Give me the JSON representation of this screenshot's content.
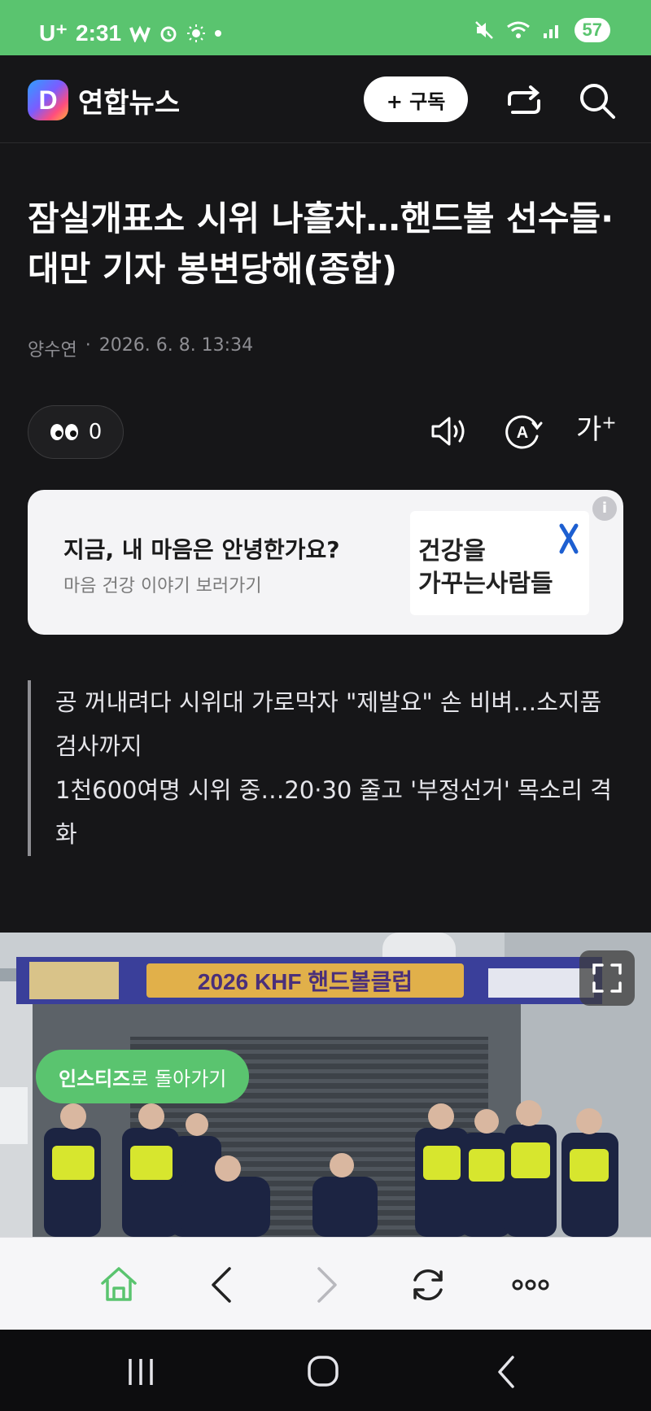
{
  "status": {
    "carrier": "U⁺",
    "time": "2:31",
    "battery": "57"
  },
  "header": {
    "logo_letter": "D",
    "brand": "연합뉴스",
    "subscribe_label": "+ 구독"
  },
  "article": {
    "title": "잠실개표소 시위 나흘차…핸드볼 선수들·대만 기자 봉변당해(종합)",
    "author": "양수연",
    "separator": "·",
    "datetime": "2026. 6. 8. 13:34",
    "reaction_count": "0",
    "font_control": "가",
    "summary": [
      "공 꺼내려다 시위대 가로막자 \"제발요\" 손 비벼…소지품 검사까지",
      "1천600여명 시위 중…20·30 줄고 '부정선거' 목소리 격화"
    ]
  },
  "ad": {
    "headline": "지금, 내 마음은 안녕한가요?",
    "subline": "마음 건강 이야기 보러가기",
    "image_line1": "건강을",
    "image_line2": "가꾸는사람들",
    "info_icon": "i"
  },
  "photo": {
    "banner_text": "2026 KHF 핸드볼클럽",
    "instiz_strong": "인스티즈",
    "instiz_rest": "로 돌아가기"
  },
  "colors": {
    "accent_green": "#5ac46f",
    "background": "#161618"
  }
}
